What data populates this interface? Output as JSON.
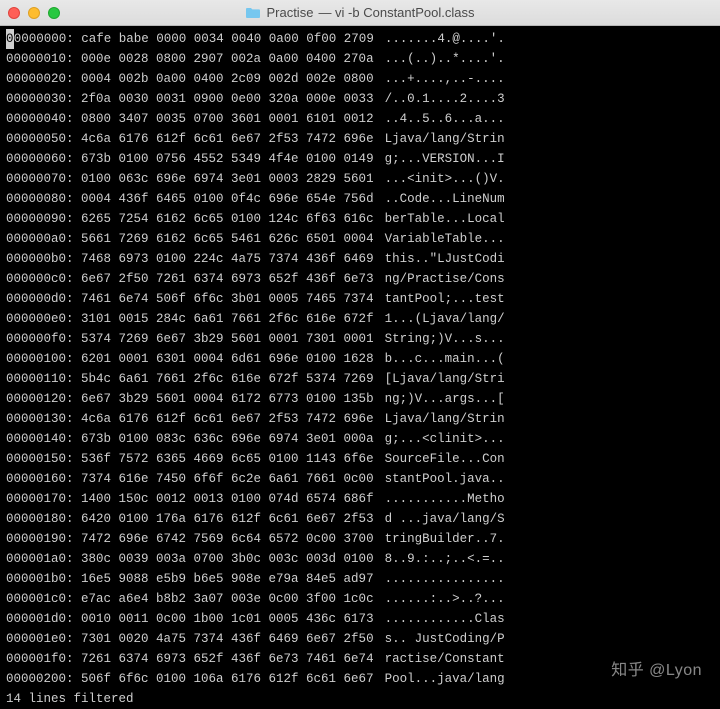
{
  "window": {
    "folder_name": "Practise",
    "title_suffix": "— vi -b ConstantPool.class"
  },
  "hexdump": {
    "rows": [
      {
        "offset": "00000000:",
        "hex": "cafe babe 0000 0034 0040 0a00 0f00 2709",
        "ascii": ".......4.@....'."
      },
      {
        "offset": "00000010:",
        "hex": "000e 0028 0800 2907 002a 0a00 0400 270a",
        "ascii": "...(..)..*....'."
      },
      {
        "offset": "00000020:",
        "hex": "0004 002b 0a00 0400 2c09 002d 002e 0800",
        "ascii": "...+....,..-...."
      },
      {
        "offset": "00000030:",
        "hex": "2f0a 0030 0031 0900 0e00 320a 000e 0033",
        "ascii": "/..0.1....2....3"
      },
      {
        "offset": "00000040:",
        "hex": "0800 3407 0035 0700 3601 0001 6101 0012",
        "ascii": "..4..5..6...a..."
      },
      {
        "offset": "00000050:",
        "hex": "4c6a 6176 612f 6c61 6e67 2f53 7472 696e",
        "ascii": "Ljava/lang/Strin"
      },
      {
        "offset": "00000060:",
        "hex": "673b 0100 0756 4552 5349 4f4e 0100 0149",
        "ascii": "g;...VERSION...I"
      },
      {
        "offset": "00000070:",
        "hex": "0100 063c 696e 6974 3e01 0003 2829 5601",
        "ascii": "...<init>...()V."
      },
      {
        "offset": "00000080:",
        "hex": "0004 436f 6465 0100 0f4c 696e 654e 756d",
        "ascii": "..Code...LineNum"
      },
      {
        "offset": "00000090:",
        "hex": "6265 7254 6162 6c65 0100 124c 6f63 616c",
        "ascii": "berTable...Local"
      },
      {
        "offset": "000000a0:",
        "hex": "5661 7269 6162 6c65 5461 626c 6501 0004",
        "ascii": "VariableTable..."
      },
      {
        "offset": "000000b0:",
        "hex": "7468 6973 0100 224c 4a75 7374 436f 6469",
        "ascii": "this..\"LJustCodi"
      },
      {
        "offset": "000000c0:",
        "hex": "6e67 2f50 7261 6374 6973 652f 436f 6e73",
        "ascii": "ng/Practise/Cons"
      },
      {
        "offset": "000000d0:",
        "hex": "7461 6e74 506f 6f6c 3b01 0005 7465 7374",
        "ascii": "tantPool;...test"
      },
      {
        "offset": "000000e0:",
        "hex": "3101 0015 284c 6a61 7661 2f6c 616e 672f",
        "ascii": "1...(Ljava/lang/"
      },
      {
        "offset": "000000f0:",
        "hex": "5374 7269 6e67 3b29 5601 0001 7301 0001",
        "ascii": "String;)V...s..."
      },
      {
        "offset": "00000100:",
        "hex": "6201 0001 6301 0004 6d61 696e 0100 1628",
        "ascii": "b...c...main...("
      },
      {
        "offset": "00000110:",
        "hex": "5b4c 6a61 7661 2f6c 616e 672f 5374 7269",
        "ascii": "[Ljava/lang/Stri"
      },
      {
        "offset": "00000120:",
        "hex": "6e67 3b29 5601 0004 6172 6773 0100 135b",
        "ascii": "ng;)V...args...["
      },
      {
        "offset": "00000130:",
        "hex": "4c6a 6176 612f 6c61 6e67 2f53 7472 696e",
        "ascii": "Ljava/lang/Strin"
      },
      {
        "offset": "00000140:",
        "hex": "673b 0100 083c 636c 696e 6974 3e01 000a",
        "ascii": "g;...<clinit>..."
      },
      {
        "offset": "00000150:",
        "hex": "536f 7572 6365 4669 6c65 0100 1143 6f6e",
        "ascii": "SourceFile...Con"
      },
      {
        "offset": "00000160:",
        "hex": "7374 616e 7450 6f6f 6c2e 6a61 7661 0c00",
        "ascii": "stantPool.java.."
      },
      {
        "offset": "00000170:",
        "hex": "1400 150c 0012 0013 0100 074d 6574 686f",
        "ascii": "...........Metho"
      },
      {
        "offset": "00000180:",
        "hex": "6420 0100 176a 6176 612f 6c61 6e67 2f53",
        "ascii": "d ...java/lang/S"
      },
      {
        "offset": "00000190:",
        "hex": "7472 696e 6742 7569 6c64 6572 0c00 3700",
        "ascii": "tringBuilder..7."
      },
      {
        "offset": "000001a0:",
        "hex": "380c 0039 003a 0700 3b0c 003c 003d 0100",
        "ascii": "8..9.:..;..<.=.."
      },
      {
        "offset": "000001b0:",
        "hex": "16e5 9088 e5b9 b6e5 908e e79a 84e5 ad97",
        "ascii": "................"
      },
      {
        "offset": "000001c0:",
        "hex": "e7ac a6e4 b8b2 3a07 003e 0c00 3f00 1c0c",
        "ascii": "......:..>..?..."
      },
      {
        "offset": "000001d0:",
        "hex": "0010 0011 0c00 1b00 1c01 0005 436c 6173",
        "ascii": "............Clas"
      },
      {
        "offset": "000001e0:",
        "hex": "7301 0020 4a75 7374 436f 6469 6e67 2f50",
        "ascii": "s.. JustCoding/P"
      },
      {
        "offset": "000001f0:",
        "hex": "7261 6374 6973 652f 436f 6e73 7461 6e74",
        "ascii": "ractise/Constant"
      },
      {
        "offset": "00000200:",
        "hex": "506f 6f6c 0100 106a 6176 612f 6c61 6e67",
        "ascii": "Pool...java/lang"
      }
    ],
    "statusline": "14 lines filtered"
  },
  "watermark": "知乎 @Lyon"
}
